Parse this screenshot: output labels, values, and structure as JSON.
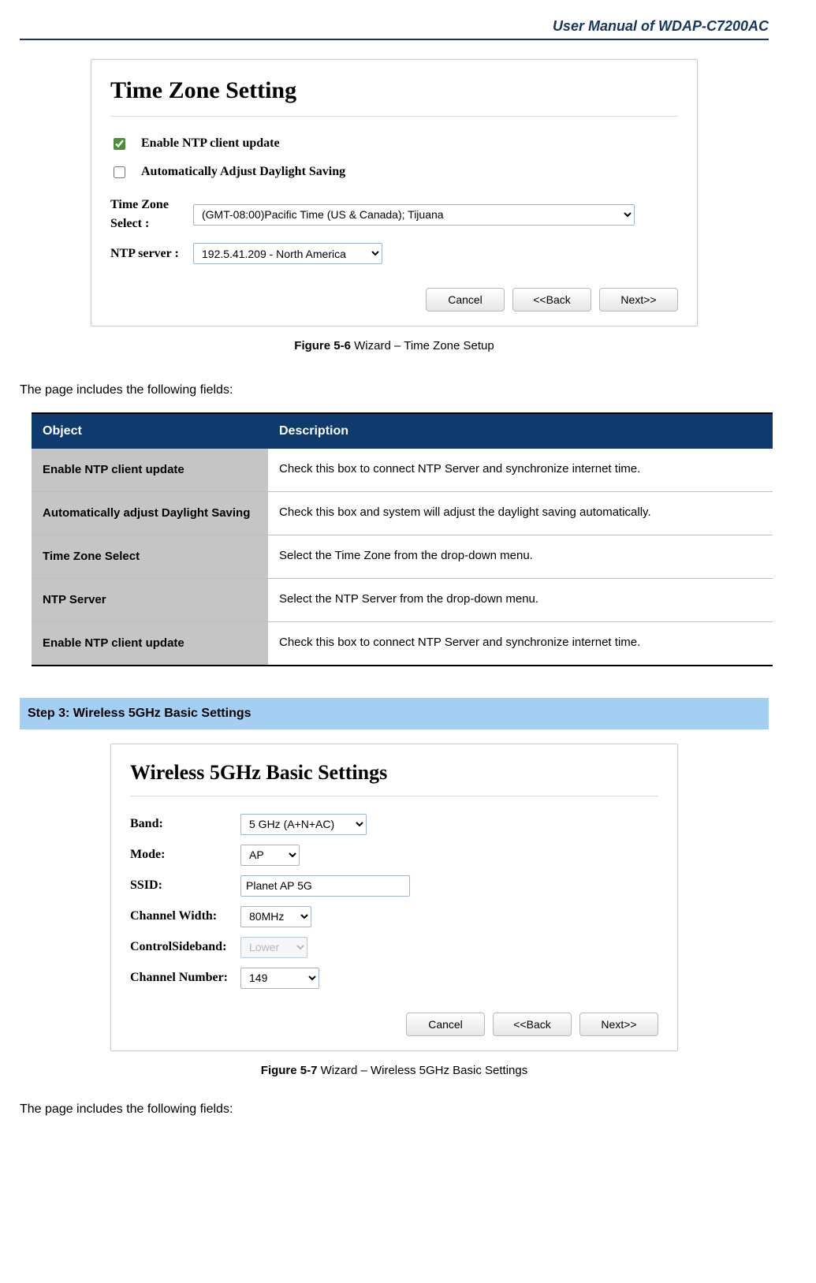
{
  "header": {
    "title": "User Manual of WDAP-C7200AC"
  },
  "figure1": {
    "panel_title": "Time Zone Setting",
    "chk_ntp_label": "Enable NTP client update",
    "chk_ntp_checked": true,
    "chk_dst_label": "Automatically Adjust Daylight Saving",
    "chk_dst_checked": false,
    "tz_label": "Time Zone Select :",
    "tz_value": "(GMT-08:00)Pacific Time (US & Canada); Tijuana",
    "ntp_label": "NTP server :",
    "ntp_value": "192.5.41.209 - North America",
    "buttons": {
      "cancel": "Cancel",
      "back": "<<Back",
      "next": "Next>>"
    },
    "caption_bold": "Figure 5-6",
    "caption_rest": " Wizard – Time Zone Setup"
  },
  "intro1": "The page includes the following fields:",
  "table1": {
    "head_obj": "Object",
    "head_desc": "Description",
    "rows": [
      {
        "obj": "Enable NTP client update",
        "desc": "Check this box to connect NTP Server and synchronize internet time."
      },
      {
        "obj": "Automatically adjust Daylight Saving",
        "desc": "Check this box and system will adjust the daylight saving automatically."
      },
      {
        "obj": "Time Zone Select",
        "desc": "Select the Time Zone from the drop-down menu."
      },
      {
        "obj": "NTP Server",
        "desc": "Select the NTP Server from the drop-down menu."
      },
      {
        "obj": "Enable NTP client update",
        "desc": "Check this box to connect NTP Server and synchronize internet time."
      }
    ]
  },
  "step3": {
    "title": "Step 3: Wireless 5GHz Basic Settings"
  },
  "figure2": {
    "panel_title": "Wireless 5GHz Basic Settings",
    "band_label": "Band:",
    "band_value": "5 GHz (A+N+AC)",
    "mode_label": "Mode:",
    "mode_value": "AP",
    "ssid_label": "SSID:",
    "ssid_value": "Planet AP 5G",
    "cw_label": "Channel Width:",
    "cw_value": "80MHz",
    "sb_label": "ControlSideband:",
    "sb_value": "Lower",
    "cn_label": "Channel Number:",
    "cn_value": "149",
    "buttons": {
      "cancel": "Cancel",
      "back": "<<Back",
      "next": "Next>>"
    },
    "caption_bold": "Figure 5-7",
    "caption_rest": " Wizard – Wireless 5GHz Basic Settings"
  },
  "intro2": "The page includes the following fields:"
}
